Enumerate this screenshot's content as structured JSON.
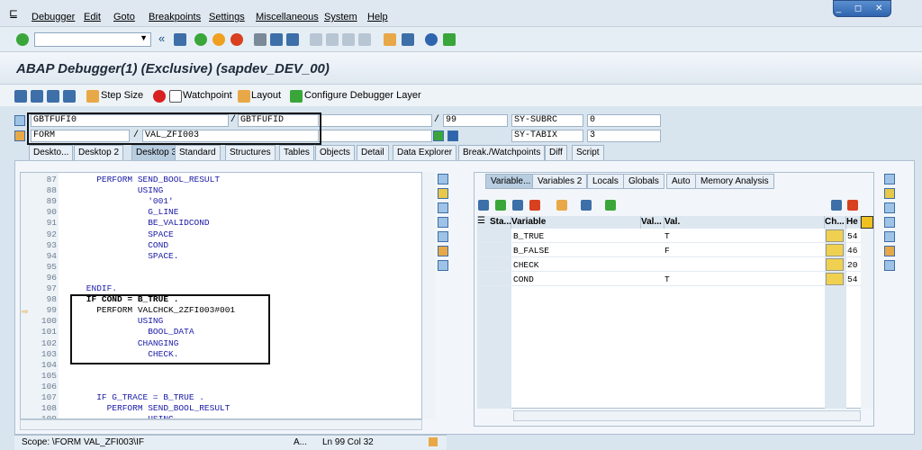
{
  "menu": {
    "items": [
      "Debugger",
      "Edit",
      "Goto",
      "Breakpoints",
      "Settings",
      "Miscellaneous",
      "System",
      "Help"
    ]
  },
  "window_controls": "_ ◻ ✕",
  "toolbar": {
    "cmd_value": ""
  },
  "header": {
    "title": "ABAP Debugger(1)  (Exclusive) (sapdev_DEV_00)"
  },
  "app_toolbar": {
    "step_size": "Step Size",
    "watchpoint": "Watchpoint",
    "layout": "Layout",
    "configure": "Configure Debugger Layer"
  },
  "context": {
    "program1": "GBTFUFI0",
    "program2": "GBTFUFID",
    "type": "FORM",
    "name": "VAL_ZFI003",
    "line": "99",
    "sysubrc_label": "SY-SUBRC",
    "sysubrc_value": "0",
    "sytabix_label": "SY-TABIX",
    "sytabix_value": "3",
    "sep": "/"
  },
  "tabs": [
    "Deskto...",
    "Desktop 2",
    "Desktop 3",
    "Standard",
    "Structures",
    "Tables",
    "Objects",
    "Detail",
    "Data Explorer",
    "Break./Watchpoints",
    "Diff",
    "Script"
  ],
  "code": [
    {
      "n": "87",
      "t": "      PERFORM SEND_BOOL_RESULT"
    },
    {
      "n": "88",
      "t": "              USING"
    },
    {
      "n": "89",
      "t": "                '001'"
    },
    {
      "n": "90",
      "t": "                G_LINE"
    },
    {
      "n": "91",
      "t": "                BE_VALIDCOND"
    },
    {
      "n": "92",
      "t": "                SPACE"
    },
    {
      "n": "93",
      "t": "                COND"
    },
    {
      "n": "94",
      "t": "                SPACE."
    },
    {
      "n": "95",
      "t": ""
    },
    {
      "n": "96",
      "t": ""
    },
    {
      "n": "97",
      "t": "    ENDIF."
    },
    {
      "n": "98",
      "t": "    IF COND = B_TRUE ."
    },
    {
      "n": "99",
      "t": "      PERFORM VALCHCK_2ZFI003#001"
    },
    {
      "n": "100",
      "t": "              USING"
    },
    {
      "n": "101",
      "t": "                BOOL_DATA"
    },
    {
      "n": "102",
      "t": "              CHANGING"
    },
    {
      "n": "103",
      "t": "                CHECK."
    },
    {
      "n": "104",
      "t": ""
    },
    {
      "n": "105",
      "t": ""
    },
    {
      "n": "106",
      "t": ""
    },
    {
      "n": "107",
      "t": "      IF G_TRACE = B_TRUE ."
    },
    {
      "n": "108",
      "t": "        PERFORM SEND_BOOL_RESULT"
    },
    {
      "n": "109",
      "t": "                USING"
    }
  ],
  "var_tabs": [
    "Variable...",
    "Variables 2",
    "Locals",
    "Globals",
    "Auto",
    "Memory Analysis"
  ],
  "var_headers": {
    "sta": "Sta...",
    "variable": "Variable",
    "val_type": "Val...",
    "val": "Val.",
    "ch": "Ch...",
    "he": "He"
  },
  "variables": [
    {
      "name": "B_TRUE",
      "val": "T",
      "hex": "54"
    },
    {
      "name": "B_FALSE",
      "val": "F",
      "hex": "46"
    },
    {
      "name": "CHECK",
      "val": "",
      "hex": "20"
    },
    {
      "name": "COND",
      "val": "T",
      "hex": "54"
    }
  ],
  "status": {
    "scope": "Scope: \\FORM VAL_ZFI003\\IF",
    "mode": "A...",
    "pos": "Ln  99 Col  32"
  },
  "colors": {
    "accent": "#1a1aa8",
    "keyword": "#1a1aa8",
    "highlight": "#111111"
  }
}
